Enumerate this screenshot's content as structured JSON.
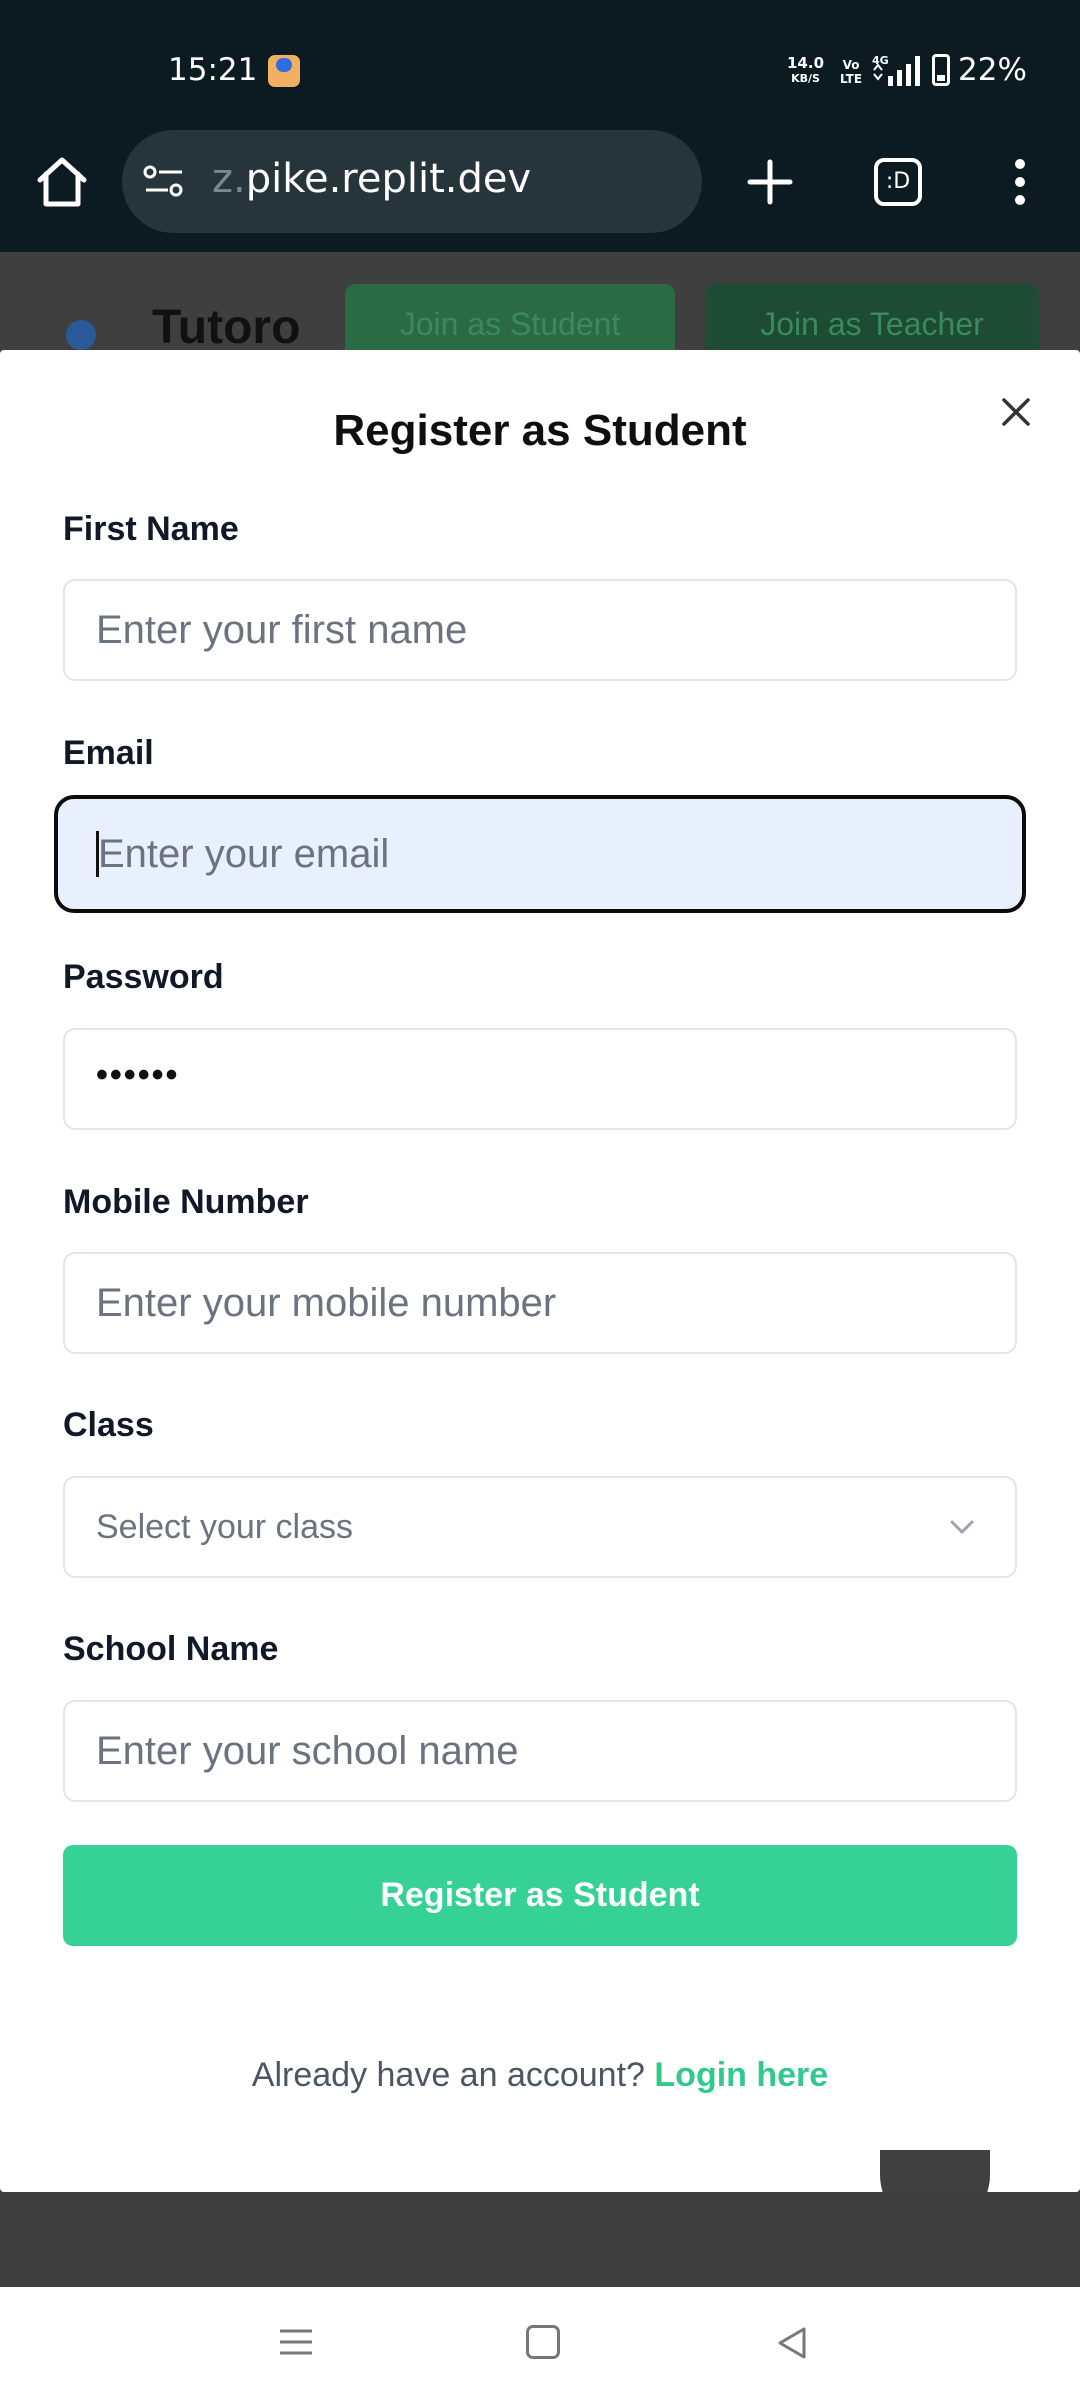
{
  "status_bar": {
    "time": "15:21",
    "net_speed_value": "14.0",
    "net_speed_unit": "KB/S",
    "volte_top": "Vo",
    "volte_bottom": "LTE",
    "network_type": "4G",
    "battery": "22%",
    "icons": [
      "app-notification-icon",
      "signal-icon",
      "battery-icon"
    ]
  },
  "browser": {
    "url": "pike.replit.dev",
    "url_prefix_faded": "z.",
    "tabs_label": ":D",
    "icons": [
      "home-icon",
      "site-info-icon",
      "plus-icon",
      "tabs-icon",
      "more-vert-icon"
    ]
  },
  "background_page": {
    "brand": "Tutoro",
    "join_student": "Join as Student",
    "join_teacher": "Join as Teacher"
  },
  "modal": {
    "title": "Register as Student",
    "fields": {
      "first_name": {
        "label": "First Name",
        "placeholder": "Enter your first name",
        "value": ""
      },
      "email": {
        "label": "Email",
        "placeholder": "Enter your email",
        "value": "",
        "focused": true
      },
      "password": {
        "label": "Password",
        "value_masked": "••••••"
      },
      "mobile": {
        "label": "Mobile Number",
        "placeholder": "Enter your mobile number",
        "value": ""
      },
      "class": {
        "label": "Class",
        "selected": "Select your class"
      },
      "school": {
        "label": "School Name",
        "placeholder": "Enter your school name",
        "value": ""
      }
    },
    "submit_label": "Register as Student",
    "login_prompt": "Already have an account?",
    "login_link": "Login here"
  },
  "colors": {
    "accent": "#36d194",
    "link": "#34c98c",
    "focus_bg": "#e8effd",
    "status_bg": "#0c1b22"
  }
}
